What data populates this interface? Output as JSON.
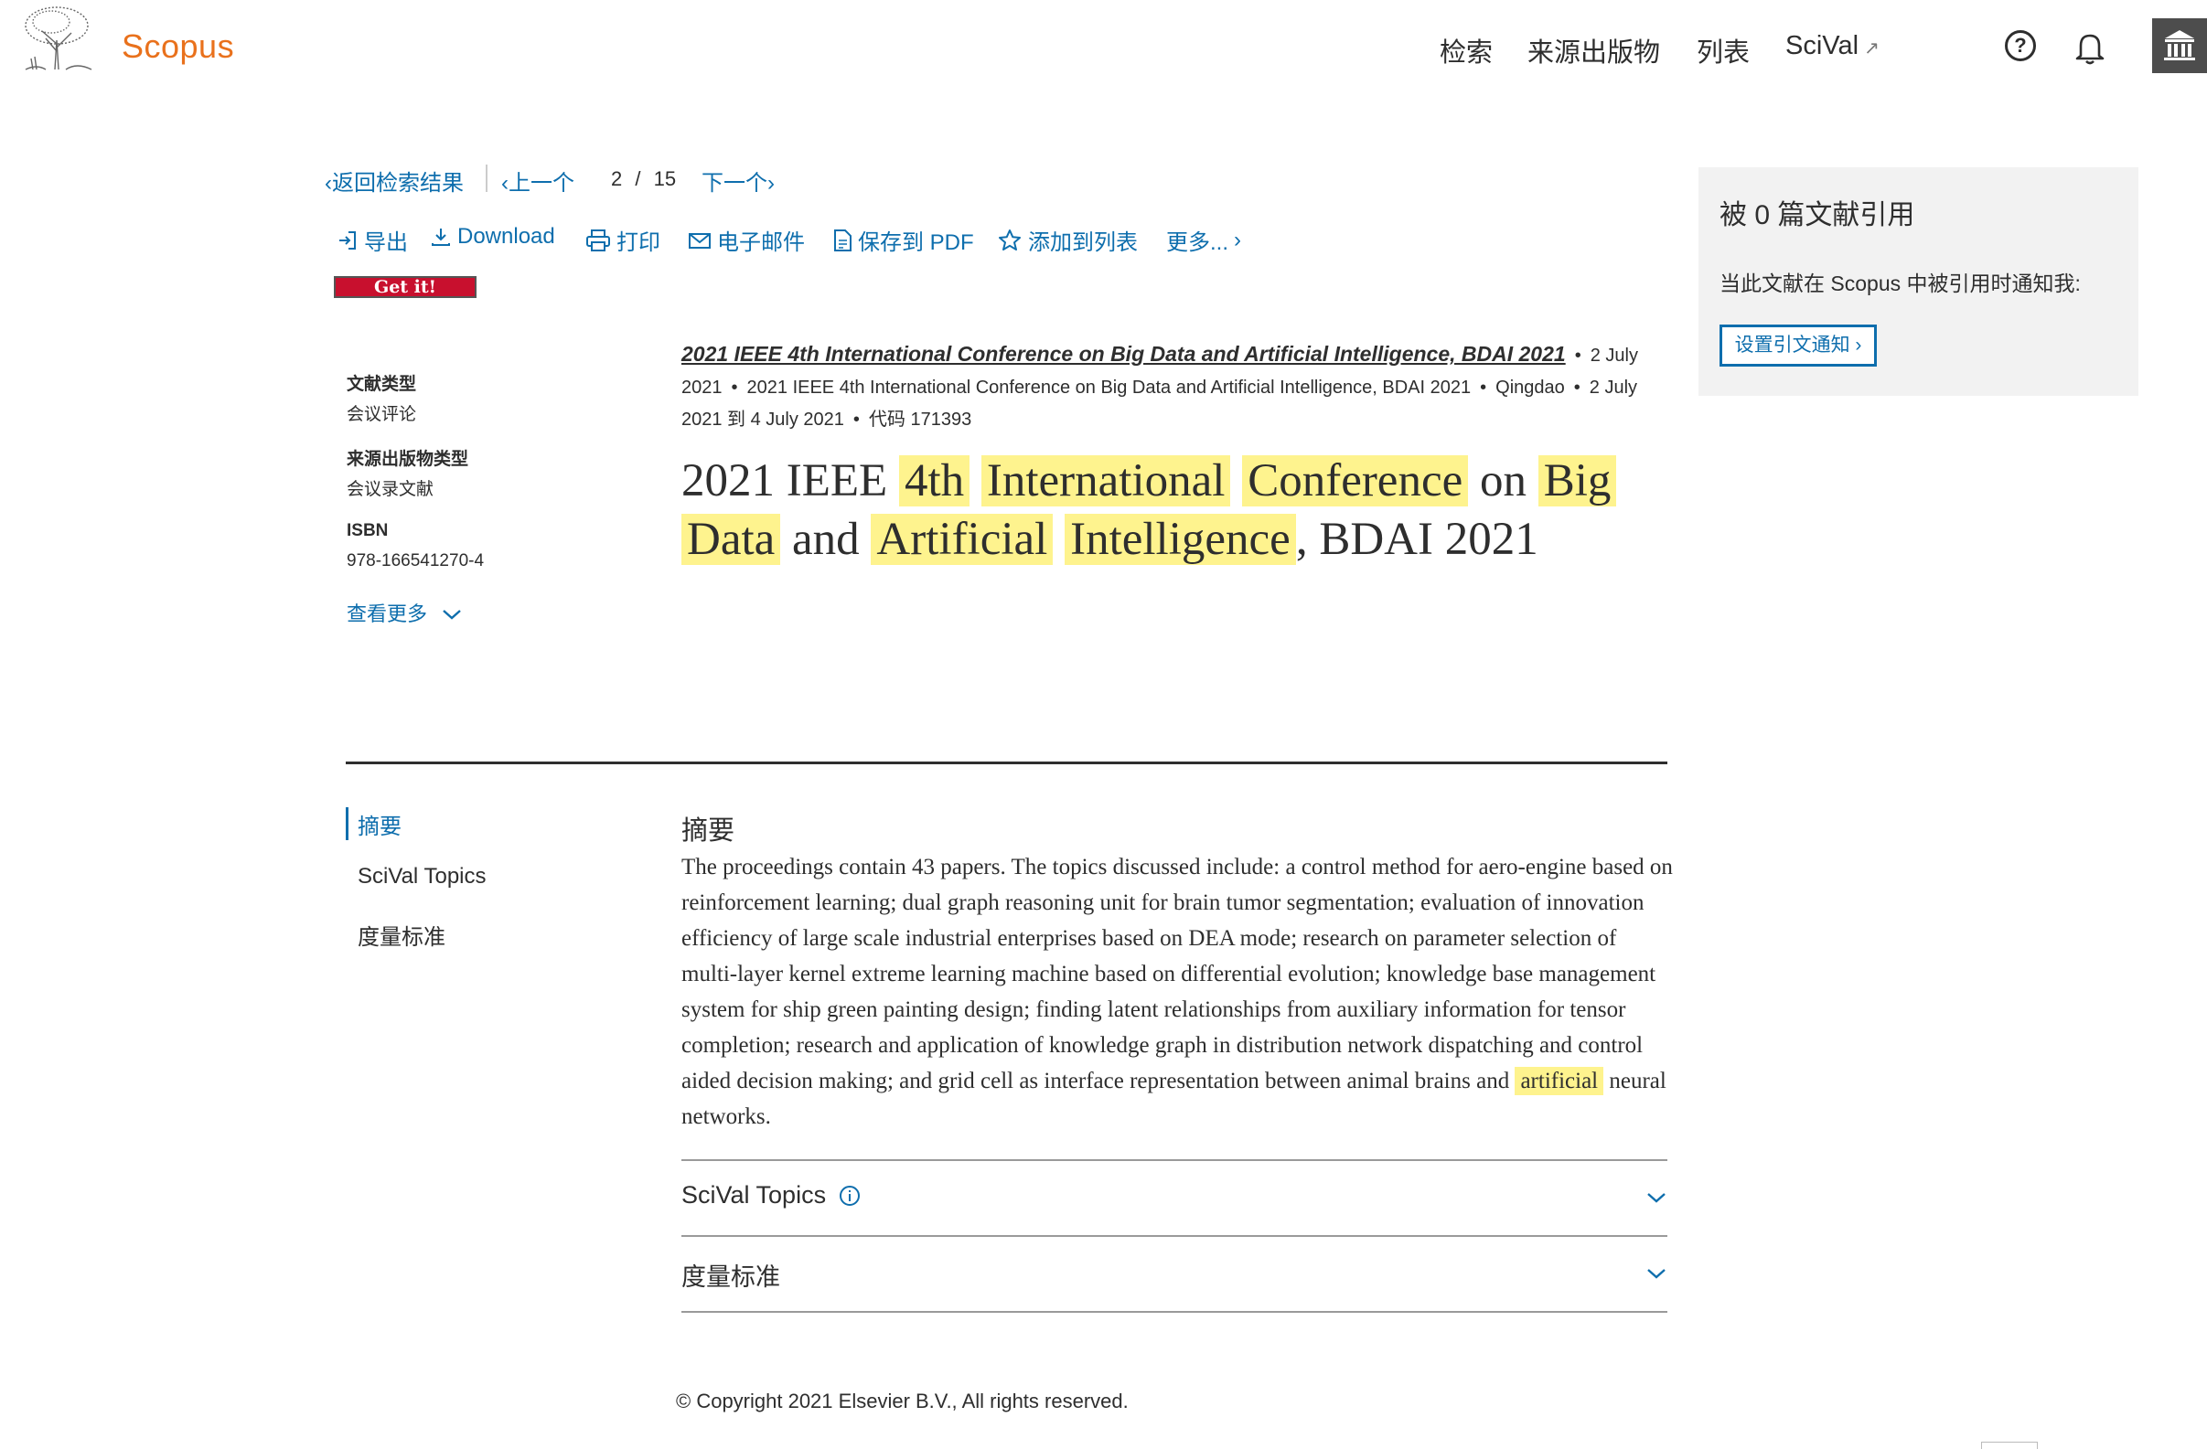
{
  "header": {
    "brand": "Scopus",
    "nav": [
      "检索",
      "来源出版物",
      "列表",
      "SciVal"
    ],
    "scival_arrow": "↗",
    "help_icon": "?",
    "icons": [
      "elsevier-tree-logo",
      "help-icon",
      "bell-icon",
      "institution-icon"
    ]
  },
  "doc_nav": {
    "back": "返回检索结果",
    "prev": "上一个",
    "position": "2",
    "separator": "/",
    "total": "15",
    "next": "下一个"
  },
  "toolbar": {
    "export": "导出",
    "download": "Download",
    "print": "打印",
    "email": "电子邮件",
    "save_pdf": "保存到 PDF",
    "add_list": "添加到列表",
    "more": "更多..."
  },
  "getit": "Get it!",
  "meta": {
    "doc_type_label": "文献类型",
    "doc_type_value": "会议评论",
    "source_type_label": "来源出版物类型",
    "source_type_value": "会议录文献",
    "isbn_label": "ISBN",
    "isbn_value": "978-166541270-4",
    "see_more": "查看更多"
  },
  "source": {
    "title": "2021 IEEE 4th International Conference on Big Data and Artificial Intelligence, BDAI 2021",
    "date": "2 July 2021",
    "conference": "2021 IEEE 4th International Conference on Big Data and Artificial Intelligence, BDAI 2021",
    "location": "Qingdao",
    "conf_dates": "2 July 2021 到 4 July 2021",
    "code": "代码 171393",
    "dot": "•"
  },
  "title_parts": [
    {
      "text": "2021 IEEE",
      "hl": false
    },
    {
      "text": "4th",
      "hl": true
    },
    {
      "text": "International",
      "hl": true
    },
    {
      "text": "Conference",
      "hl": true
    },
    {
      "text": "on",
      "hl": false
    },
    {
      "text": "Big",
      "hl": true
    },
    {
      "text": "Data",
      "hl": true
    },
    {
      "text": "and",
      "hl": false
    },
    {
      "text": "Artificial",
      "hl": true
    },
    {
      "text": "Intelligence",
      "hl": true
    },
    {
      "text": ", BDAI 2021",
      "hl": false
    }
  ],
  "section_nav": [
    "摘要",
    "SciVal Topics",
    "度量标准"
  ],
  "abstract": {
    "heading": "摘要",
    "text_before": "The proceedings contain 43 papers. The topics discussed include: a control method for aero-engine based on reinforcement learning; dual graph reasoning unit for brain tumor segmentation; evaluation of innovation efficiency of large scale industrial enterprises based on DEA mode; research on parameter selection of multi-layer kernel extreme learning machine based on differential evolution; knowledge base management system for ship green painting design; finding latent relationships from auxiliary information for tensor completion; research and application of knowledge graph in distribution network dispatching and control aided decision making; and grid cell as interface representation between animal brains and",
    "highlight": "artificial",
    "text_after": "neural networks."
  },
  "accordion": {
    "scival": "SciVal Topics",
    "metrics": "度量标准"
  },
  "copyright": "© Copyright 2021 Elsevier B.V., All rights reserved.",
  "cite_panel": {
    "title": "被 0 篇文献引用",
    "desc": "当此文献在 Scopus 中被引用时通知我:",
    "button": "设置引文通知"
  },
  "colors": {
    "brand": "#e9711c",
    "link": "#0e6ead",
    "highlight": "#fef38e",
    "panel": "#f2f2f2"
  }
}
